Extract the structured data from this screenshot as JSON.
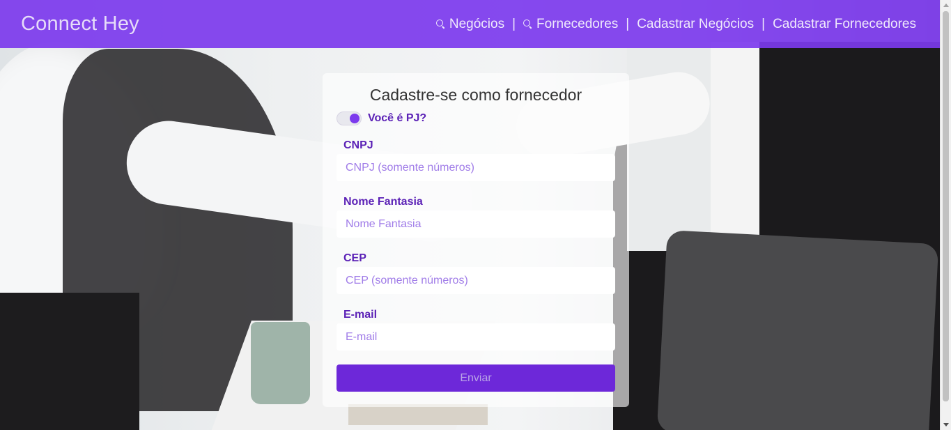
{
  "header": {
    "brand": "Connect Hey",
    "nav": [
      {
        "label": "Negócios",
        "icon": "search-icon"
      },
      {
        "label": "Fornecedores",
        "icon": "search-icon"
      },
      {
        "label": "Cadastrar Negócios"
      },
      {
        "label": "Cadastrar Fornecedores"
      }
    ],
    "separator": "|"
  },
  "form": {
    "title": "Cadastre-se como fornecedor",
    "toggle": {
      "label": "Você é PJ?",
      "checked": true
    },
    "fields": [
      {
        "label": "CNPJ",
        "placeholder": "CNPJ (somente números)",
        "value": ""
      },
      {
        "label": "Nome Fantasia",
        "placeholder": "Nome Fantasia",
        "value": ""
      },
      {
        "label": "CEP",
        "placeholder": "CEP (somente números)",
        "value": ""
      },
      {
        "label": "E-mail",
        "placeholder": "E-mail",
        "value": ""
      }
    ],
    "submit_label": "Enviar"
  },
  "colors": {
    "accent": "#7c3aed",
    "label": "#5b21b6",
    "button": "#6d28d9"
  }
}
